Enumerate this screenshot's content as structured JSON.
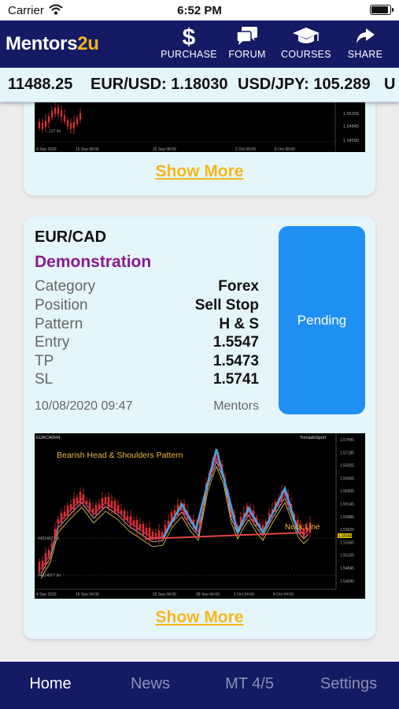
{
  "status_bar": {
    "carrier": "Carrier",
    "time": "6:52 PM",
    "battery_level": 0.95
  },
  "app": {
    "brand_prefix": "Mentors",
    "brand_accent": "2u",
    "brand_accent_color": "#f3b21a",
    "header_color": "#141a63"
  },
  "nav": [
    {
      "label": "PURCHASE",
      "icon": "dollar-icon"
    },
    {
      "label": "FORUM",
      "icon": "chat-bubbles-icon"
    },
    {
      "label": "COURSES",
      "icon": "graduation-cap-icon"
    },
    {
      "label": "SHARE",
      "icon": "share-arrow-icon"
    }
  ],
  "ticker": [
    "11488.25",
    "EUR/USD: 1.18030",
    "USD/JPY: 105.289",
    "U"
  ],
  "previous_card": {
    "show_more": "Show More",
    "chart_price_labels": [
      "1.55165",
      "1.54845",
      "1.54590"
    ],
    "chart_date_labels": [
      "4 Sep 2020",
      "15 Sep 08:00",
      "22 Sep 08:00",
      "2 Oct 08:00",
      "8 Oct 08:00"
    ],
    "chart_note": "...127 lm"
  },
  "signal": {
    "pair": "EUR/CAD",
    "type": "Demonstration",
    "fields": [
      {
        "label": "Category",
        "value": "Forex"
      },
      {
        "label": "Position",
        "value": "Sell Stop"
      },
      {
        "label": "Pattern",
        "value": "H & S"
      },
      {
        "label": "Entry",
        "value": "1.5547"
      },
      {
        "label": "TP",
        "value": "1.5473"
      },
      {
        "label": "SL",
        "value": "1.5741"
      }
    ],
    "date": "10/08/2020 09:47",
    "author": "Mentors",
    "status": "Pending",
    "status_color": "#1f8ff2",
    "chart": {
      "symbol": "EURCADH4",
      "brand": "TornadoSport",
      "pattern_label": "Bearish Head & Shoulders Pattern",
      "neckline_label": "Neck Line",
      "current_price": "1.55090",
      "price_labels": [
        "1.57445",
        "1.57185",
        "1.56925",
        "1.56665",
        "1.56405",
        "1.56145",
        "1.55885",
        "1.55625",
        "1.55365",
        "1.55105",
        "1.54845",
        "1.54590"
      ],
      "date_labels": [
        "4 Sep 2020",
        "15 Sep 04:00",
        "22 Sep 04:00",
        "28 Sep 04:00",
        "2 Oct 04:00",
        "8 Oct 04:00"
      ],
      "left_notes": [
        "#4214077 sl",
        "#4214077 lm"
      ]
    },
    "show_more": "Show More"
  },
  "tabs": [
    {
      "label": "Home",
      "active": true
    },
    {
      "label": "News",
      "active": false
    },
    {
      "label": "MT 4/5",
      "active": false
    },
    {
      "label": "Settings",
      "active": false
    }
  ]
}
